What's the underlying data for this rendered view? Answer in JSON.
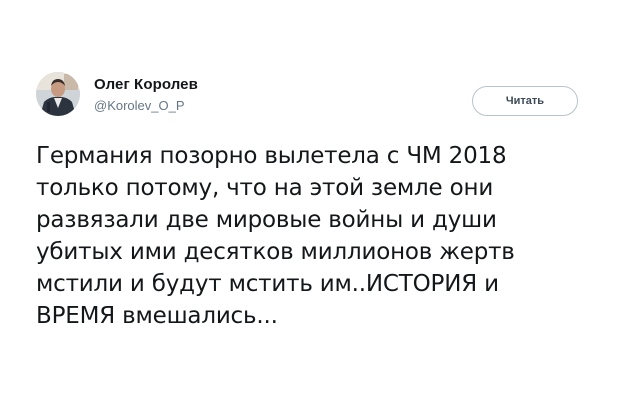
{
  "author": {
    "display_name": "Олег Королев",
    "handle": "@Korolev_O_P",
    "avatar_icon": "avatar-photo-icon"
  },
  "follow_button": {
    "label": "Читать"
  },
  "tweet": {
    "text": "Германия позорно вылетела с ЧМ 2018\nтолько потому, что на этой земле они\nразвязали две мировые войны и души\nубитых ими десятков миллионов жертв\nмстили и будут мстить им..ИСТОРИЯ и\nВРЕМЯ вмешались..."
  },
  "colors": {
    "text": "#14171a",
    "handle": "#657786",
    "button_border": "#b8c4cc"
  }
}
